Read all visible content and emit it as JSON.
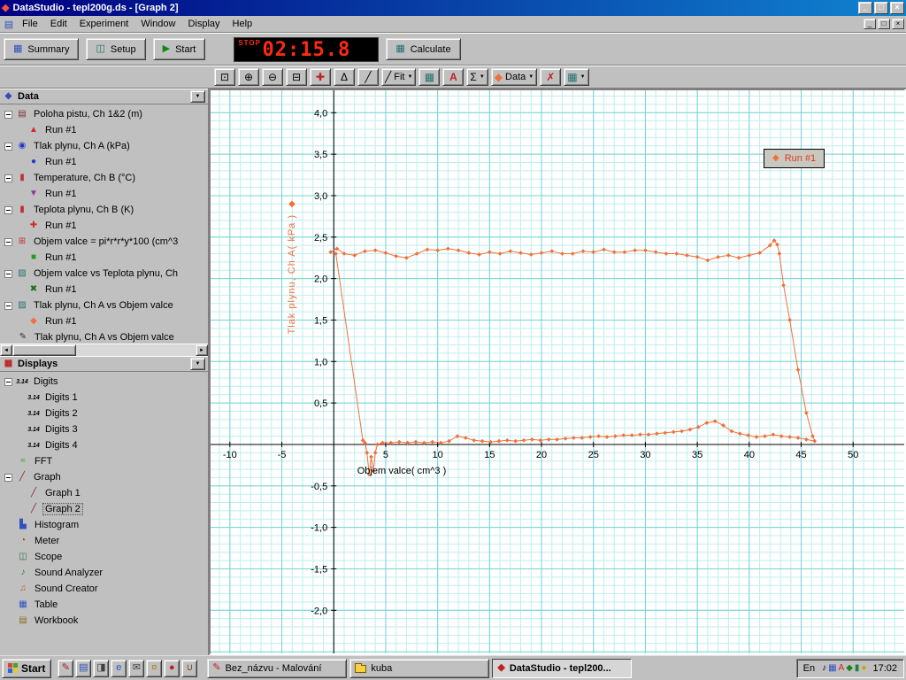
{
  "window": {
    "title": "DataStudio - tepl200g.ds - [Graph 2]"
  },
  "menu": {
    "items": [
      "File",
      "Edit",
      "Experiment",
      "Window",
      "Display",
      "Help"
    ]
  },
  "toolbar": {
    "summary": "Summary",
    "setup": "Setup",
    "start": "Start",
    "timer": {
      "label": "STOP",
      "value": "02:15.8"
    },
    "calculate": "Calculate"
  },
  "graph_toolbar": {
    "fit_label": "Fit",
    "data_label": "Data"
  },
  "sidebar": {
    "data_header": "Data",
    "displays_header": "Displays",
    "data_rows": [
      {
        "t": "Poloha pistu, Ch 1&2 (m)",
        "g": "▤",
        "c": "#7a3030",
        "cls": "has-box"
      },
      {
        "t": "Run #1",
        "g": "▲",
        "c": "#d42a2a",
        "cls": "lvl1"
      },
      {
        "t": "Tlak plynu, Ch A (kPa)",
        "g": "◉",
        "c": "#2038c8",
        "cls": "has-box"
      },
      {
        "t": "Run #1",
        "g": "●",
        "c": "#2038c8",
        "cls": "lvl1"
      },
      {
        "t": "Temperature, Ch B (°C)",
        "g": "▮",
        "c": "#c03030",
        "cls": "has-box"
      },
      {
        "t": "Run #1",
        "g": "▼",
        "c": "#9030b0",
        "cls": "lvl1"
      },
      {
        "t": "Teplota plynu, Ch B (K)",
        "g": "▮",
        "c": "#c03030",
        "cls": "has-box"
      },
      {
        "t": "Run #1",
        "g": "✚",
        "c": "#d42a2a",
        "cls": "lvl1"
      },
      {
        "t": "Objem valce = pi*r*r*y*100 (cm^3",
        "g": "⊞",
        "c": "#c03030",
        "cls": "has-box"
      },
      {
        "t": "Run #1",
        "g": "■",
        "c": "#1f9e1f",
        "cls": "lvl1"
      },
      {
        "t": "Objem valce vs Teplota plynu, Ch",
        "g": "▨",
        "c": "#207070",
        "cls": "has-box"
      },
      {
        "t": "Run #1",
        "g": "✖",
        "c": "#167016",
        "cls": "lvl1"
      },
      {
        "t": "Tlak plynu, Ch A vs Objem valce",
        "g": "▨",
        "c": "#207070",
        "cls": "has-box"
      },
      {
        "t": "Run #1",
        "g": "◆",
        "c": "#f3703a",
        "cls": "lvl1"
      },
      {
        "t": "Tlak plynu, Ch A vs Objem valce",
        "g": "✎",
        "c": "#303030",
        "cls": "indent1"
      }
    ],
    "display_rows": [
      {
        "t": "Digits",
        "g": "3.14",
        "c": "#000000",
        "cls": "has-box small-icon"
      },
      {
        "t": "Digits 1",
        "g": "3.14",
        "c": "#000000",
        "cls": "lvl1 small-icon"
      },
      {
        "t": "Digits 2",
        "g": "3.14",
        "c": "#000000",
        "cls": "lvl1 small-icon"
      },
      {
        "t": "Digits 3",
        "g": "3.14",
        "c": "#000000",
        "cls": "lvl1 small-icon"
      },
      {
        "t": "Digits 4",
        "g": "3.14",
        "c": "#000000",
        "cls": "lvl1 small-icon"
      },
      {
        "t": "FFT",
        "g": "≈",
        "c": "#1f9e1f",
        "cls": "indent1"
      },
      {
        "t": "Graph",
        "g": "╱",
        "c": "#8b2020",
        "cls": "has-box"
      },
      {
        "t": "Graph 1",
        "g": "╱",
        "c": "#8b2020",
        "cls": "lvl1"
      },
      {
        "t": "Graph 2",
        "g": "╱",
        "c": "#8b2020",
        "cls": "lvl1 sel"
      },
      {
        "t": "Histogram",
        "g": "▙",
        "c": "#3050c0",
        "cls": "indent1"
      },
      {
        "t": "Meter",
        "g": "◔",
        "c": "#b03030",
        "cls": "indent1"
      },
      {
        "t": "Scope",
        "g": "◫",
        "c": "#2f7050",
        "cls": "indent1"
      },
      {
        "t": "Sound Analyzer",
        "g": "♪",
        "c": "#1f7f1f",
        "cls": "indent1"
      },
      {
        "t": "Sound Creator",
        "g": "♫",
        "c": "#b06020",
        "cls": "indent1"
      },
      {
        "t": "Table",
        "g": "▦",
        "c": "#3050c0",
        "cls": "indent1"
      },
      {
        "t": "Workbook",
        "g": "▤",
        "c": "#8a6d1f",
        "cls": "indent1"
      }
    ]
  },
  "chart_data": {
    "type": "scatter-line",
    "title": "",
    "xlabel": "Objem valce( cm^3 )",
    "ylabel": "Tlak plynu, Ch A( kPa )",
    "xlim": [
      -11.86,
      54.92
    ],
    "ylim": [
      -2.52,
      4.27
    ],
    "x_minor": 1,
    "y_minor": 0.1,
    "x_major": 5,
    "y_major": 0.5,
    "grid_minor_color": "#bfeeee",
    "grid_major_color": "#74d4d4",
    "x_ticks": [
      [
        -10,
        "-10"
      ],
      [
        -5,
        "-5"
      ],
      [
        5,
        "5"
      ],
      [
        10,
        "10"
      ],
      [
        15,
        "15"
      ],
      [
        20,
        "20"
      ],
      [
        25,
        "25"
      ],
      [
        30,
        "30"
      ],
      [
        35,
        "35"
      ],
      [
        40,
        "40"
      ],
      [
        45,
        "45"
      ],
      [
        50,
        "50"
      ]
    ],
    "y_ticks": [
      [
        4,
        "4,0"
      ],
      [
        3.5,
        "3,5"
      ],
      [
        3,
        "3,0"
      ],
      [
        2.5,
        "2,5"
      ],
      [
        2,
        "2,0"
      ],
      [
        1.5,
        "1,5"
      ],
      [
        1,
        "1,0"
      ],
      [
        0.5,
        "0,5"
      ],
      [
        -0.5,
        "-0,5"
      ],
      [
        -1,
        "-1,0"
      ],
      [
        -1.5,
        "-1,5"
      ],
      [
        -2,
        "-2,0"
      ]
    ],
    "legend": {
      "label": "Run #1",
      "position": "top-right"
    },
    "series": [
      {
        "name": "Run #1",
        "color": "#f3703a",
        "points": [
          [
            -0.3,
            2.32
          ],
          [
            0.3,
            2.36
          ],
          [
            1,
            2.3
          ],
          [
            2,
            2.28
          ],
          [
            3,
            2.33
          ],
          [
            4,
            2.34
          ],
          [
            5,
            2.31
          ],
          [
            6,
            2.27
          ],
          [
            7,
            2.25
          ],
          [
            8,
            2.3
          ],
          [
            9,
            2.35
          ],
          [
            10,
            2.34
          ],
          [
            11,
            2.36
          ],
          [
            12,
            2.34
          ],
          [
            13,
            2.31
          ],
          [
            14,
            2.29
          ],
          [
            15,
            2.32
          ],
          [
            16,
            2.3
          ],
          [
            17,
            2.33
          ],
          [
            18,
            2.31
          ],
          [
            19,
            2.29
          ],
          [
            20,
            2.31
          ],
          [
            21,
            2.33
          ],
          [
            22,
            2.3
          ],
          [
            23,
            2.3
          ],
          [
            24,
            2.33
          ],
          [
            25,
            2.32
          ],
          [
            26,
            2.35
          ],
          [
            27,
            2.32
          ],
          [
            28,
            2.32
          ],
          [
            29,
            2.34
          ],
          [
            30,
            2.34
          ],
          [
            31,
            2.32
          ],
          [
            32,
            2.3
          ],
          [
            33,
            2.3
          ],
          [
            34,
            2.28
          ],
          [
            35,
            2.26
          ],
          [
            36,
            2.22
          ],
          [
            37,
            2.26
          ],
          [
            38,
            2.28
          ],
          [
            39,
            2.25
          ],
          [
            40,
            2.28
          ],
          [
            41,
            2.31
          ],
          [
            42,
            2.4
          ],
          [
            42.4,
            2.46
          ],
          [
            42.7,
            2.41
          ],
          [
            42.9,
            2.3
          ],
          [
            43.3,
            1.92
          ],
          [
            43.9,
            1.5
          ],
          [
            44.7,
            0.9
          ],
          [
            45.5,
            0.38
          ],
          [
            46.1,
            0.1
          ],
          [
            46.3,
            0.04
          ],
          [
            45.5,
            0.06
          ],
          [
            44.7,
            0.08
          ],
          [
            43.9,
            0.09
          ],
          [
            43.1,
            0.1
          ],
          [
            42.3,
            0.12
          ],
          [
            41.5,
            0.1
          ],
          [
            40.7,
            0.09
          ],
          [
            39.9,
            0.11
          ],
          [
            39.1,
            0.13
          ],
          [
            38.3,
            0.16
          ],
          [
            37.5,
            0.23
          ],
          [
            36.7,
            0.28
          ],
          [
            35.9,
            0.26
          ],
          [
            35.1,
            0.21
          ],
          [
            34.3,
            0.18
          ],
          [
            33.5,
            0.16
          ],
          [
            32.7,
            0.15
          ],
          [
            31.9,
            0.14
          ],
          [
            31.1,
            0.13
          ],
          [
            30.3,
            0.12
          ],
          [
            29.5,
            0.12
          ],
          [
            28.7,
            0.11
          ],
          [
            27.9,
            0.11
          ],
          [
            27.1,
            0.1
          ],
          [
            26.3,
            0.09
          ],
          [
            25.5,
            0.1
          ],
          [
            24.7,
            0.09
          ],
          [
            23.9,
            0.08
          ],
          [
            23.1,
            0.08
          ],
          [
            22.3,
            0.07
          ],
          [
            21.5,
            0.06
          ],
          [
            20.7,
            0.06
          ],
          [
            19.9,
            0.05
          ],
          [
            19.1,
            0.06
          ],
          [
            18.3,
            0.05
          ],
          [
            17.5,
            0.04
          ],
          [
            16.7,
            0.05
          ],
          [
            15.9,
            0.04
          ],
          [
            15.1,
            0.03
          ],
          [
            14.3,
            0.04
          ],
          [
            13.5,
            0.05
          ],
          [
            12.7,
            0.08
          ],
          [
            11.9,
            0.1
          ],
          [
            11.1,
            0.04
          ],
          [
            10.3,
            0.02
          ],
          [
            9.5,
            0.03
          ],
          [
            8.7,
            0.02
          ],
          [
            7.9,
            0.03
          ],
          [
            7.1,
            0.02
          ],
          [
            6.3,
            0.03
          ],
          [
            5.5,
            0.02
          ],
          [
            4.7,
            0.02
          ],
          [
            4.2,
            0
          ],
          [
            4,
            -0.1
          ],
          [
            3.8,
            -0.32
          ],
          [
            3.6,
            -0.15
          ],
          [
            3.4,
            -0.36
          ],
          [
            3.2,
            -0.1
          ],
          [
            3,
            0.02
          ],
          [
            2.8,
            0.05
          ],
          [
            0.2,
            2.3
          ]
        ]
      }
    ]
  },
  "taskbar": {
    "start_label": "Start",
    "quicklaunch": [
      {
        "n": "pen-icon",
        "g": "✎",
        "c": "#b02020"
      },
      {
        "n": "notes-icon",
        "g": "▤",
        "c": "#3050c0"
      },
      {
        "n": "printer-icon",
        "g": "◨",
        "c": "#404040"
      },
      {
        "n": "internet-explorer-icon",
        "g": "e",
        "c": "#2060d0"
      },
      {
        "n": "mail-icon",
        "g": "✉",
        "c": "#404040"
      },
      {
        "n": "keys-icon",
        "g": "¤",
        "c": "#b08000"
      },
      {
        "n": "opera-icon",
        "g": "●",
        "c": "#c02020"
      },
      {
        "n": "java-icon",
        "g": "∪",
        "c": "#7a4a20"
      }
    ],
    "tasks": [
      {
        "label": "Bez_názvu - Malování"
      },
      {
        "label": "kuba"
      },
      {
        "label": "DataStudio - tepl200..."
      }
    ],
    "tray": {
      "lang": "En",
      "icons": [
        {
          "n": "volume-icon",
          "g": "♪",
          "c": "#000000"
        },
        {
          "n": "display-settings-icon",
          "g": "▦",
          "c": "#3050c0"
        },
        {
          "n": "antivirus-icon",
          "g": "A",
          "c": "#d02020"
        },
        {
          "n": "scheduler-icon",
          "g": "◆",
          "c": "#208020"
        },
        {
          "n": "modem-icon",
          "g": "▮",
          "c": "#208040"
        },
        {
          "n": "clock-agent-icon",
          "g": "●",
          "c": "#d0a000"
        }
      ],
      "time": "17:02"
    }
  },
  "icons": {
    "app": "◆",
    "doc": "▤",
    "minimize": "_",
    "restore": "□",
    "close": "×",
    "summary": "▦",
    "setup": "◫",
    "start_play": "▶",
    "calculate": "▦",
    "dropdown": "▼",
    "drop_small": "▼",
    "scale_fit": "⊡",
    "zoom_in": "⊕",
    "zoom_out": "⊖",
    "zoom_select": "⊟",
    "smart_tool": "✚",
    "delta_tool": "Δ",
    "slope_tool": "╱",
    "fit_icon": "╱",
    "calc_small": "▦",
    "text_tool": "A",
    "sigma": "Σ",
    "data_diamond": "◆",
    "delete_x": "✗",
    "settings_grid": "▦",
    "scroll_left": "◄",
    "scroll_right": "►",
    "data_panel": "◆",
    "displays_panel": "▦",
    "legend_marker": "◆",
    "ylabel_marker": "◆",
    "paint_task": "✎",
    "datastudio_task": "◆"
  },
  "colors": {
    "titlebar_left": "#000080",
    "titlebar_right": "#1084d0",
    "accent": "#f3703a",
    "legend_text": "#e03c1e",
    "timer_red": "#ff2a10",
    "grid_minor": "#bfeeee",
    "grid_major": "#74d4d4"
  }
}
